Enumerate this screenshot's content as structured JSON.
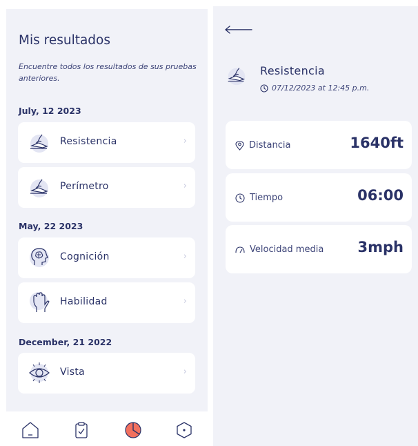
{
  "results": {
    "title": "Mis resultados",
    "subtitle": "Encuentre todos los resultados de sus pruebas anteriores.",
    "groups": [
      {
        "date": "July, 12 2023",
        "items": [
          {
            "label": "Resistencia",
            "icon": "swimmer-icon"
          },
          {
            "label": "Perímetro",
            "icon": "swimmer-icon"
          }
        ]
      },
      {
        "date": "May, 22 2023",
        "items": [
          {
            "label": "Cognición",
            "icon": "brain-head-icon"
          },
          {
            "label": "Habilidad",
            "icon": "hand-icon"
          }
        ]
      },
      {
        "date": "December, 21 2022",
        "items": [
          {
            "label": "Vista",
            "icon": "eye-icon"
          }
        ]
      }
    ],
    "chevron": "›"
  },
  "bottom_nav": {
    "items": [
      "home-icon",
      "clipboard-icon",
      "chart-icon",
      "hexagon-icon"
    ],
    "active_index": 2
  },
  "detail": {
    "title": "Resistencia",
    "datetime": "07/12/2023 at 12:45 p.m.",
    "stats": [
      {
        "label": "Distancia",
        "value": "1640ft",
        "icon": "location-pin-icon"
      },
      {
        "label": "Tiempo",
        "value": "06:00",
        "icon": "clock-icon"
      },
      {
        "label": "Velocidad media",
        "value": "3mph",
        "icon": "speedometer-icon"
      }
    ]
  },
  "colors": {
    "primary": "#2a3267",
    "background": "#f1f2f8",
    "card": "#ffffff",
    "accent_active": "#f2705e",
    "icon_circle": "#e3e5f3"
  }
}
